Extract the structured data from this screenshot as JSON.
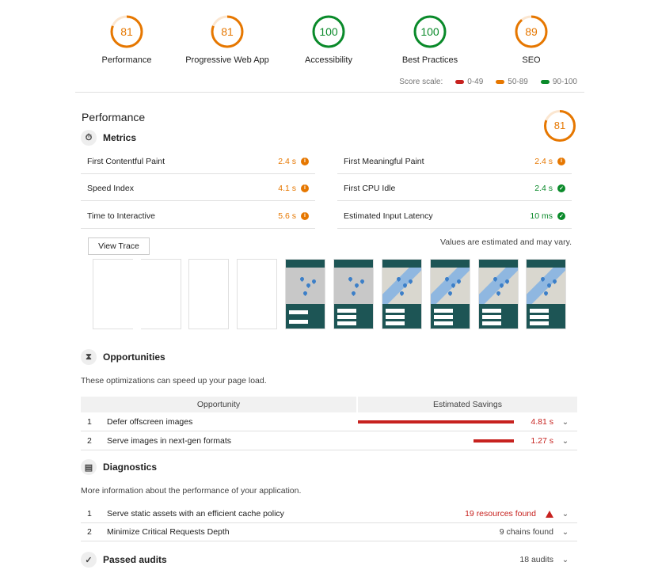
{
  "gauges": [
    {
      "score": "81",
      "label": "Performance",
      "color": "#e67700",
      "fraction": 0.81
    },
    {
      "score": "81",
      "label": "Progressive Web App",
      "color": "#e67700",
      "fraction": 0.81
    },
    {
      "score": "100",
      "label": "Accessibility",
      "color": "#0a8a2a",
      "fraction": 1.0
    },
    {
      "score": "100",
      "label": "Best Practices",
      "color": "#0a8a2a",
      "fraction": 1.0
    },
    {
      "score": "89",
      "label": "SEO",
      "color": "#e67700",
      "fraction": 0.89
    }
  ],
  "score_scale": {
    "label": "Score scale:",
    "items": [
      {
        "range": "0-49",
        "color": "#c7221f"
      },
      {
        "range": "50-89",
        "color": "#e67700"
      },
      {
        "range": "90-100",
        "color": "#0a8a2a"
      }
    ]
  },
  "performance": {
    "title": "Performance",
    "score": "81",
    "metrics_title": "Metrics",
    "metrics": [
      {
        "name": "First Contentful Paint",
        "value": "2.4 s",
        "status": "orange"
      },
      {
        "name": "First Meaningful Paint",
        "value": "2.4 s",
        "status": "orange"
      },
      {
        "name": "Speed Index",
        "value": "4.1 s",
        "status": "orange"
      },
      {
        "name": "First CPU Idle",
        "value": "2.4 s",
        "status": "green"
      },
      {
        "name": "Time to Interactive",
        "value": "5.6 s",
        "status": "orange"
      },
      {
        "name": "Estimated Input Latency",
        "value": "10 ms",
        "status": "green"
      }
    ],
    "view_trace_label": "View Trace",
    "estimate_note": "Values are estimated and may vary."
  },
  "opportunities": {
    "title": "Opportunities",
    "description": "These optimizations can speed up your page load.",
    "col_opportunity": "Opportunity",
    "col_savings": "Estimated Savings",
    "rows": [
      {
        "num": "1",
        "name": "Defer offscreen images",
        "savings": "4.81 s",
        "fraction": 1.0
      },
      {
        "num": "2",
        "name": "Serve images in next-gen formats",
        "savings": "1.27 s",
        "fraction": 0.26
      }
    ]
  },
  "diagnostics": {
    "title": "Diagnostics",
    "description": "More information about the performance of your application.",
    "rows": [
      {
        "num": "1",
        "name": "Serve static assets with an efficient cache policy",
        "info": "19 resources found"
      },
      {
        "num": "2",
        "name": "Minimize Critical Requests Depth",
        "info": "9 chains found"
      }
    ]
  },
  "passed": {
    "title": "Passed audits",
    "count": "18 audits"
  }
}
